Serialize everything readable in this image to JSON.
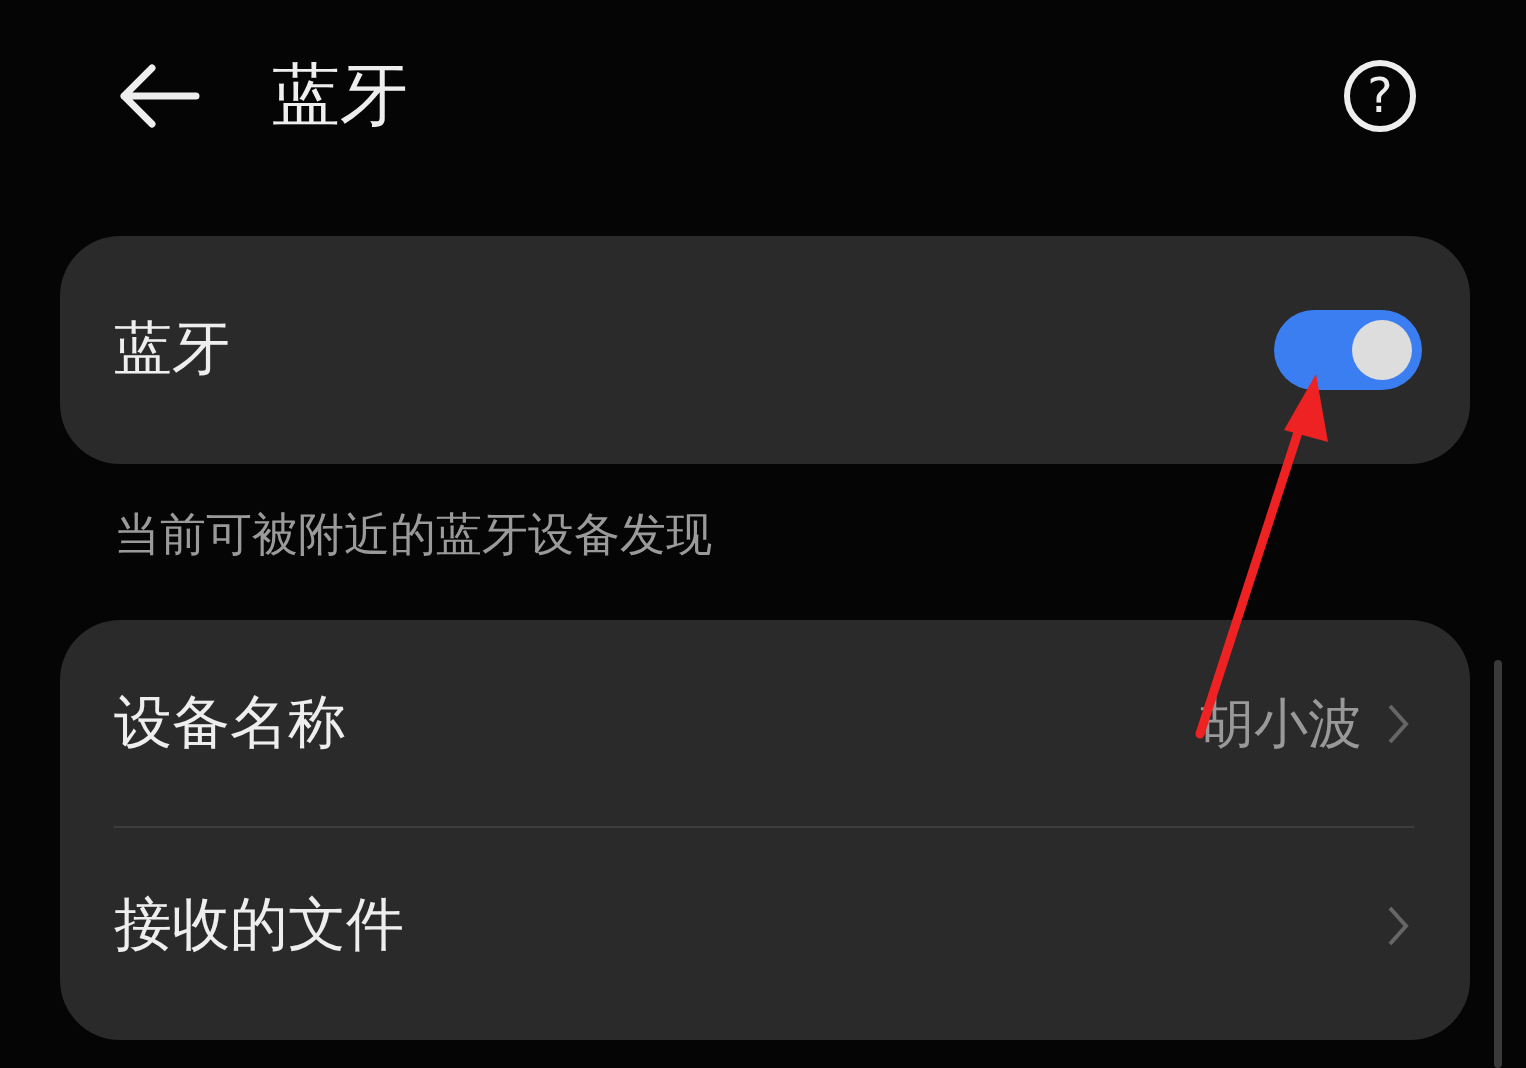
{
  "header": {
    "title": "蓝牙",
    "help": "?"
  },
  "bluetooth": {
    "label": "蓝牙",
    "on": true
  },
  "hint": "当前可被附近的蓝牙设备发现",
  "rows": [
    {
      "label": "设备名称",
      "value": "胡小波"
    },
    {
      "label": "接收的文件"
    }
  ]
}
